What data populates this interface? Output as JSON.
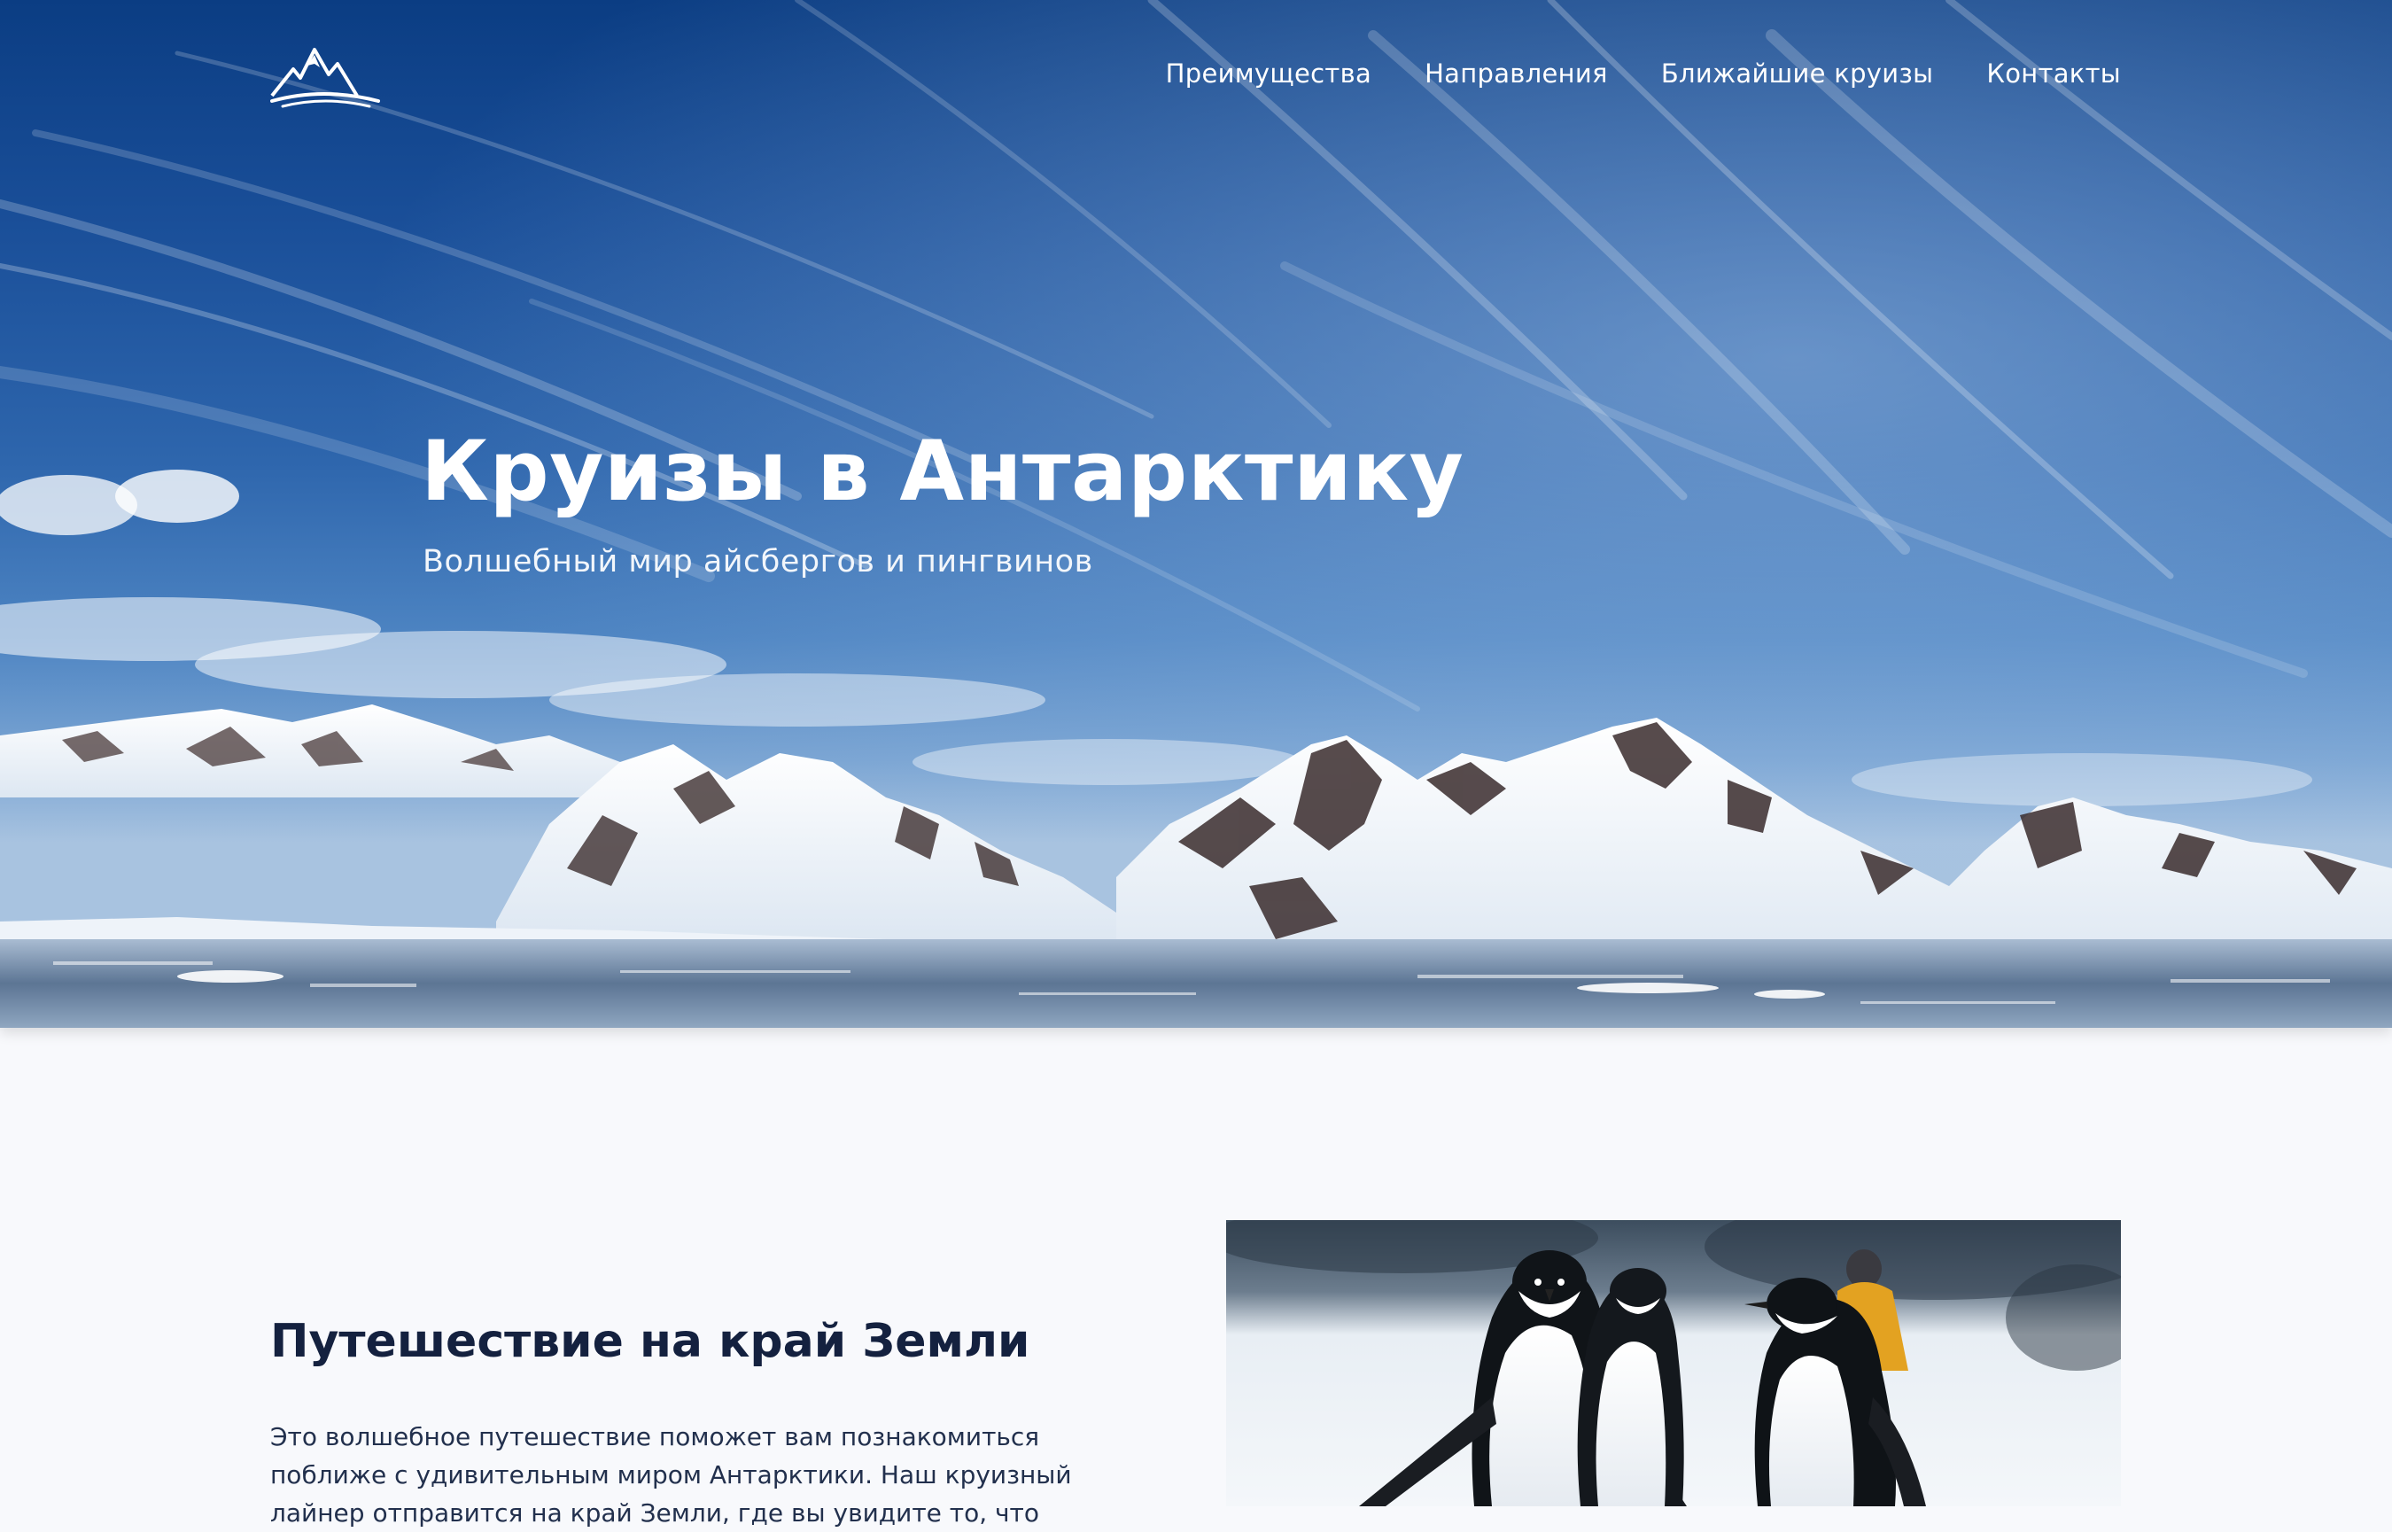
{
  "nav": {
    "items": [
      {
        "label": "Преимущества"
      },
      {
        "label": "Направления"
      },
      {
        "label": "Ближайшие круизы"
      },
      {
        "label": "Контакты"
      }
    ]
  },
  "hero": {
    "title": "Круизы в Антарктику",
    "subtitle": "Волшебный мир айсбергов и пингвинов"
  },
  "about": {
    "title": "Путешествие на край Земли",
    "text": "Это волшебное путешествие поможет вам познакомиться поближе с удивительным миром Антарктики. Наш круизный лайнер отправится на край Земли, где вы увидите то, что"
  },
  "icons": {
    "logo": "mountain-logo-icon"
  },
  "colors": {
    "sky_dark": "#0b3d83",
    "text_dark": "#14213f",
    "background": "#f8f9fc"
  }
}
